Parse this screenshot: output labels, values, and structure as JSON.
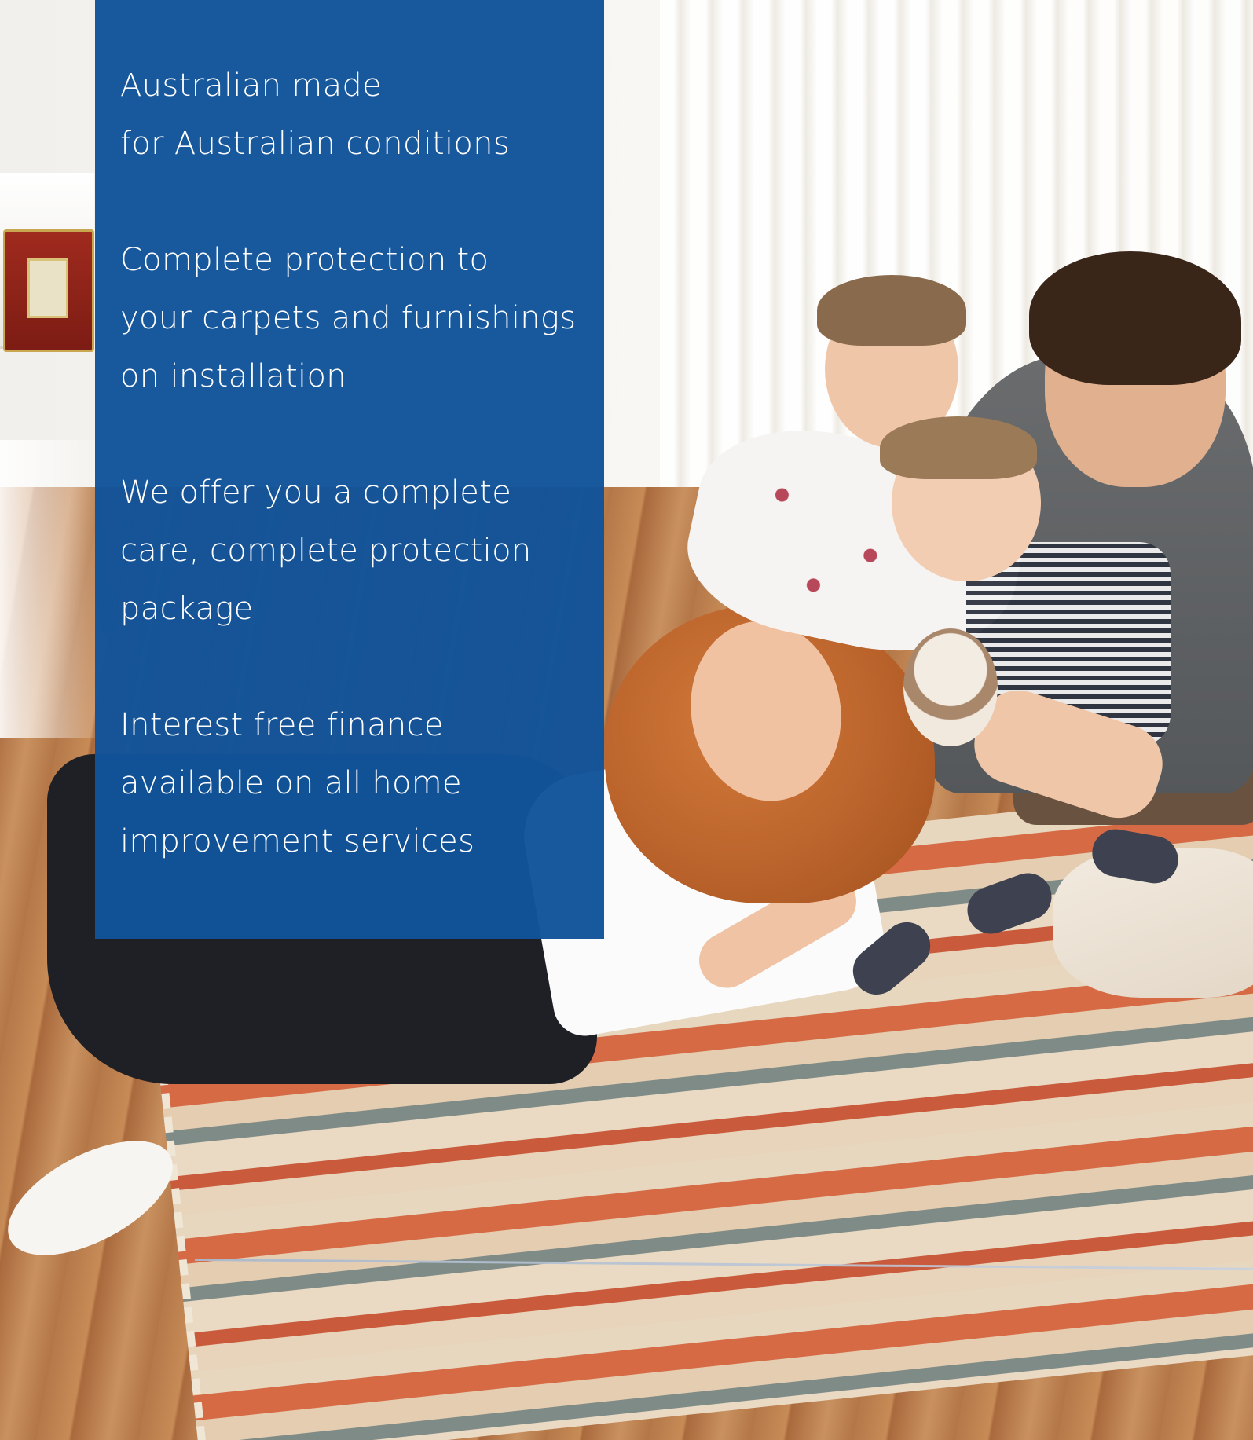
{
  "panel": {
    "blocks": [
      {
        "lines": [
          "Australian made",
          "for Australian conditions"
        ]
      },
      {
        "lines": [
          "Complete protection to",
          "your carpets and furnishings",
          "on installation"
        ]
      },
      {
        "lines": [
          "We offer you a complete",
          "care, complete protection",
          "package"
        ]
      },
      {
        "lines": [
          "Interest free finance",
          "available on all home",
          "improvement services"
        ]
      }
    ]
  },
  "colors": {
    "panel_blue": "#11539a",
    "text": "#ffffff",
    "divider": "#aab9cd"
  }
}
